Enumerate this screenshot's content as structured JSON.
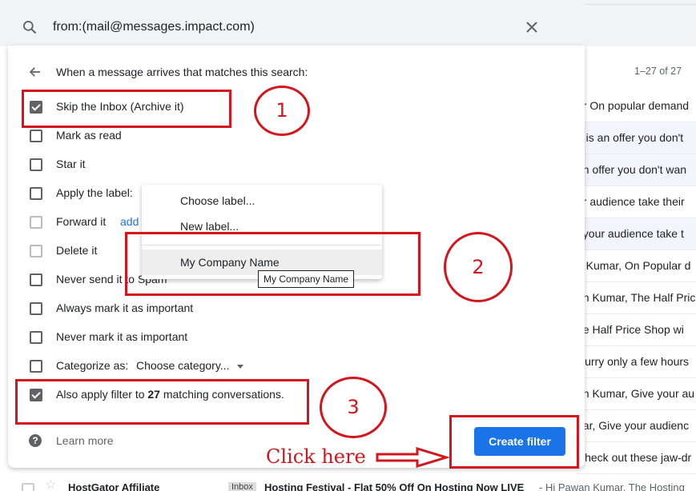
{
  "search": {
    "query": "from:(mail@messages.impact.com)"
  },
  "filter_panel": {
    "heading": "When a message arrives that matches this search:",
    "options": [
      {
        "label": "Skip the Inbox (Archive it)",
        "checked": true
      },
      {
        "label": "Mark as read",
        "checked": false
      },
      {
        "label": "Star it",
        "checked": false
      },
      {
        "label": "Apply the label:",
        "checked": false
      },
      {
        "label": "Forward it",
        "checked": false,
        "link": "add"
      },
      {
        "label": "Delete it",
        "checked": false
      },
      {
        "label": "Never send it to Spam",
        "checked": false
      },
      {
        "label": "Always mark it as important",
        "checked": false
      },
      {
        "label": "Never mark it as important",
        "checked": false
      },
      {
        "label": "Categorize as:",
        "checked": false,
        "select": "Choose category..."
      },
      {
        "label_pre": "Also apply filter to ",
        "label_count": "27",
        "label_post": " matching conversations.",
        "checked": true
      }
    ],
    "learn_more": "Learn more",
    "create_button": "Create filter"
  },
  "label_dropdown": {
    "items": [
      "Choose label...",
      "New label...",
      "My Company Name"
    ],
    "tooltip": "My Company Name"
  },
  "inbox": {
    "pager": "1–27 of 27",
    "snippets": [
      "ar On popular demand",
      "e is an offer you don't",
      "an offer you don't wan",
      "ur audience take their",
      "t your audience take t",
      "n Kumar, On Popular d",
      "an Kumar, The Half Pric",
      "he Half Price Shop wi",
      "Hurry only a few hours",
      "an Kumar, Give your au",
      "nar, Give your audienc",
      "Check out these jaw-dr"
    ],
    "bottom_row": {
      "sender": "HostGator Affiliate",
      "tag": "Inbox",
      "subject": "Hosting Festival - Flat 50% Off On Hosting Now LIVE",
      "snippet": " - Hi Pawan Kumar, The Hosting"
    }
  },
  "annotations": {
    "num1": "1",
    "num2": "2",
    "num3": "3",
    "click_here": "Click here",
    "color": "#d6141c"
  }
}
